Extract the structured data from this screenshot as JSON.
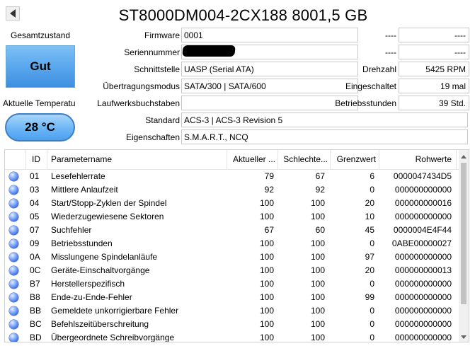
{
  "header": {
    "title": "ST8000DM004-2CX188 8001,5 GB"
  },
  "left": {
    "health_label": "Gesamtzustand",
    "health_value": "Gut",
    "temp_label": "Aktuelle Temperatu",
    "temp_value": "28 °C"
  },
  "info": {
    "firmware_label": "Firmware",
    "firmware_value": "0001",
    "serial_label": "Seriennummer",
    "serial_value": "",
    "interface_label": "Schnittstelle",
    "interface_value": "UASP (Serial ATA)",
    "transfer_label": "Übertragungsmodus",
    "transfer_value": "SATA/300 | SATA/600",
    "drive_letter_label": "Laufwerksbuchstaben",
    "drive_letter_value": "",
    "standard_label": "Standard",
    "standard_value": "ACS-3 | ACS-3 Revision 5",
    "features_label": "Eigenschaften",
    "features_value": "S.M.A.R.T., NCQ"
  },
  "right_info": {
    "r1_label": "----",
    "r1_value": "----",
    "r2_label": "----",
    "r2_value": "----",
    "rpm_label": "Drehzahl",
    "rpm_value": "5425 RPM",
    "power_on_count_label": "Eingeschaltet",
    "power_on_count_value": "19 mal",
    "power_on_hours_label": "Betriebsstunden",
    "power_on_hours_value": "39 Std."
  },
  "table": {
    "headers": {
      "id": "ID",
      "name": "Parametername",
      "current": "Aktueller ...",
      "worst": "Schlechte...",
      "threshold": "Grenzwert",
      "raw": "Rohwerte"
    },
    "rows": [
      {
        "id": "01",
        "name": "Lesefehlerrate",
        "current": "79",
        "worst": "67",
        "threshold": "6",
        "raw": "0000047434D5"
      },
      {
        "id": "03",
        "name": "Mittlere Anlaufzeit",
        "current": "92",
        "worst": "92",
        "threshold": "0",
        "raw": "000000000000"
      },
      {
        "id": "04",
        "name": "Start/Stopp-Zyklen der Spindel",
        "current": "100",
        "worst": "100",
        "threshold": "20",
        "raw": "000000000016"
      },
      {
        "id": "05",
        "name": "Wiederzugewiesene Sektoren",
        "current": "100",
        "worst": "100",
        "threshold": "10",
        "raw": "000000000000"
      },
      {
        "id": "07",
        "name": "Suchfehler",
        "current": "67",
        "worst": "60",
        "threshold": "45",
        "raw": "0000004E4F44"
      },
      {
        "id": "09",
        "name": "Betriebsstunden",
        "current": "100",
        "worst": "100",
        "threshold": "0",
        "raw": "0ABE00000027"
      },
      {
        "id": "0A",
        "name": "Misslungene Spindelanläufe",
        "current": "100",
        "worst": "100",
        "threshold": "97",
        "raw": "000000000000"
      },
      {
        "id": "0C",
        "name": "Geräte-Einschaltvorgänge",
        "current": "100",
        "worst": "100",
        "threshold": "20",
        "raw": "000000000013"
      },
      {
        "id": "B7",
        "name": "Herstellerspezifisch",
        "current": "100",
        "worst": "100",
        "threshold": "0",
        "raw": "000000000000"
      },
      {
        "id": "B8",
        "name": "Ende-zu-Ende-Fehler",
        "current": "100",
        "worst": "100",
        "threshold": "99",
        "raw": "000000000000"
      },
      {
        "id": "BB",
        "name": "Gemeldete unkorrigierbare Fehler",
        "current": "100",
        "worst": "100",
        "threshold": "0",
        "raw": "000000000000"
      },
      {
        "id": "BC",
        "name": "Befehlszeitüberschreitung",
        "current": "100",
        "worst": "100",
        "threshold": "0",
        "raw": "000000000000"
      },
      {
        "id": "BD",
        "name": "Übergeordnete Schreibvorgänge",
        "current": "100",
        "worst": "100",
        "threshold": "0",
        "raw": "000000000000"
      }
    ]
  },
  "colors": {
    "health_bg": "#5aa8ee",
    "temp_bg": "#6cb6f6",
    "status_dot": "#3d6fe0"
  }
}
